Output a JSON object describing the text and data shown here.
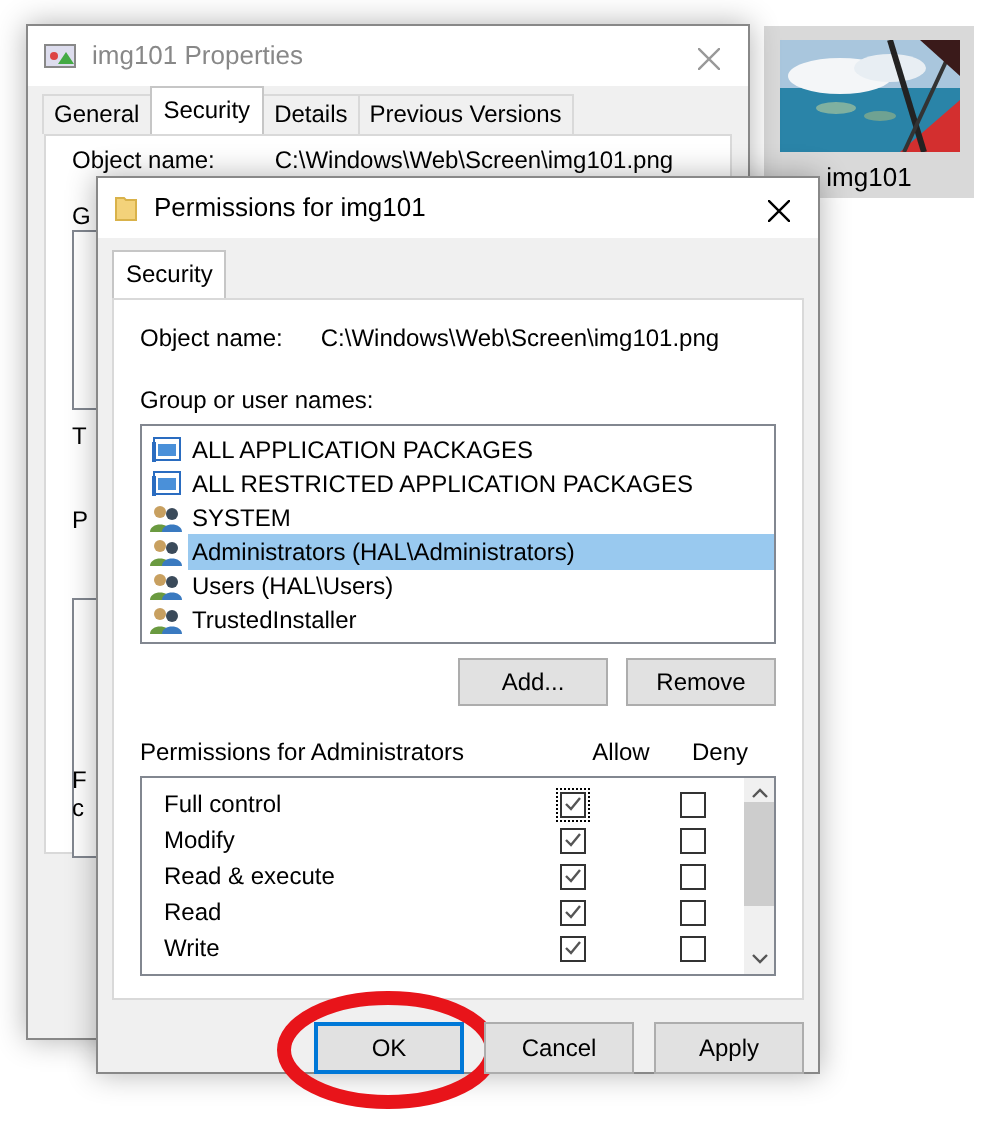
{
  "thumbnail": {
    "label": "img101"
  },
  "background_window": {
    "title": "img101 Properties",
    "tabs": [
      {
        "label": "General",
        "selected": false
      },
      {
        "label": "Security",
        "selected": true
      },
      {
        "label": "Details",
        "selected": false
      },
      {
        "label": "Previous Versions",
        "selected": false
      }
    ],
    "object_label": "Object name:",
    "object_value": "C:\\Windows\\Web\\Screen\\img101.png",
    "fragments": [
      "G",
      "T",
      "P",
      "F",
      "c"
    ]
  },
  "dialog": {
    "title": "Permissions for img101",
    "tabs": [
      {
        "label": "Security",
        "selected": true
      }
    ],
    "object_label": "Object name:",
    "object_value": "C:\\Windows\\Web\\Screen\\img101.png",
    "group_label": "Group or user names:",
    "principals": [
      {
        "name": "ALL APPLICATION PACKAGES",
        "kind": "package",
        "selected": false
      },
      {
        "name": "ALL RESTRICTED APPLICATION PACKAGES",
        "kind": "package",
        "selected": false
      },
      {
        "name": "SYSTEM",
        "kind": "users",
        "selected": false
      },
      {
        "name": "Administrators (HAL\\Administrators)",
        "kind": "users",
        "selected": true
      },
      {
        "name": "Users (HAL\\Users)",
        "kind": "users",
        "selected": false
      },
      {
        "name": "TrustedInstaller",
        "kind": "users",
        "selected": false
      }
    ],
    "list_buttons": [
      "Add...",
      "Remove"
    ],
    "permissions_label": "Permissions for Administrators",
    "allow_label": "Allow",
    "deny_label": "Deny",
    "permissions": [
      {
        "name": "Full control",
        "allow": true,
        "deny": false,
        "focused": true
      },
      {
        "name": "Modify",
        "allow": true,
        "deny": false,
        "focused": false
      },
      {
        "name": "Read & execute",
        "allow": true,
        "deny": false,
        "focused": false
      },
      {
        "name": "Read",
        "allow": true,
        "deny": false,
        "focused": false
      },
      {
        "name": "Write",
        "allow": true,
        "deny": false,
        "focused": false
      }
    ],
    "buttons": [
      {
        "label": "OK",
        "default": true,
        "circled": true
      },
      {
        "label": "Cancel",
        "default": false,
        "circled": false
      },
      {
        "label": "Apply",
        "default": false,
        "circled": false
      }
    ]
  }
}
